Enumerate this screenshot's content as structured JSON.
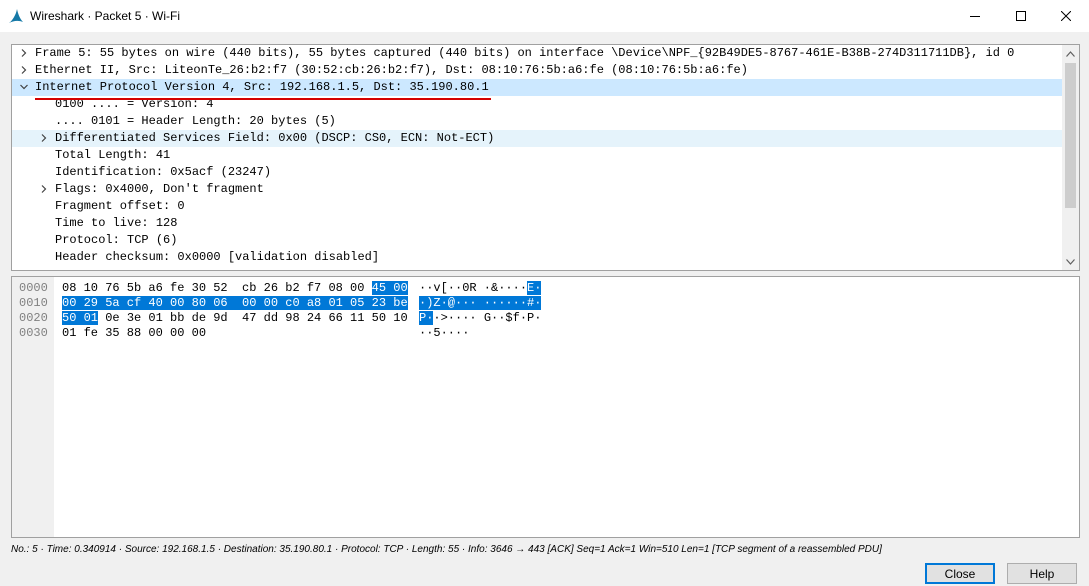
{
  "window": {
    "title": "Wireshark · Packet 5 · Wi-Fi",
    "app_icon": "wireshark-fin-icon",
    "controls": [
      "minimize-icon",
      "maximize-icon",
      "close-icon"
    ]
  },
  "tree": [
    {
      "text": "Frame 5: 55 bytes on wire (440 bits), 55 bytes captured (440 bits) on interface \\Device\\NPF_{92B49DE5-8767-461E-B38B-274D311711DB}, id 0",
      "expander": "collapsed",
      "state": "normal"
    },
    {
      "text": "Ethernet II, Src: LiteonTe_26:b2:f7 (30:52:cb:26:b2:f7), Dst: 08:10:76:5b:a6:fe (08:10:76:5b:a6:fe)",
      "expander": "collapsed",
      "state": "normal"
    },
    {
      "text": "Internet Protocol Version 4, Src: 192.168.1.5, Dst: 35.190.80.1",
      "expander": "expanded",
      "state": "selected"
    },
    {
      "text": "0100 .... = Version: 4",
      "expander": "none",
      "state": "normal"
    },
    {
      "text": ".... 0101 = Header Length: 20 bytes (5)",
      "expander": "none",
      "state": "normal"
    },
    {
      "text": "Differentiated Services Field: 0x00 (DSCP: CS0, ECN: Not-ECT)",
      "expander": "collapsed",
      "state": "highlight"
    },
    {
      "text": "Total Length: 41",
      "expander": "none",
      "state": "normal"
    },
    {
      "text": "Identification: 0x5acf (23247)",
      "expander": "none",
      "state": "normal"
    },
    {
      "text": "Flags: 0x4000, Don't fragment",
      "expander": "collapsed",
      "state": "normal"
    },
    {
      "text": "Fragment offset: 0",
      "expander": "none",
      "state": "normal"
    },
    {
      "text": "Time to live: 128",
      "expander": "none",
      "state": "normal"
    },
    {
      "text": "Protocol: TCP (6)",
      "expander": "none",
      "state": "normal"
    },
    {
      "text": "Header checksum: 0x0000 [validation disabled]",
      "expander": "none",
      "state": "normal"
    }
  ],
  "hex": [
    {
      "offset": "0000",
      "hex_plain": "08 10 76 5b a6 fe 30 52  cb 26 b2 f7 08 00 ",
      "hex_sel": "45 00",
      "ascii_plain": "··v[··0R ·&····",
      "ascii_sel": "E·"
    },
    {
      "offset": "0010",
      "hex_plain": "",
      "hex_sel": "00 29 5a cf 40 00 80 06  00 00 c0 a8 01 05 23 be",
      "ascii_plain": "",
      "ascii_sel": "·)Z·@··· ······#·"
    },
    {
      "offset": "0020",
      "hex_plain": "0e 3e 01 bb de 9d  47 dd 98 24 66 11 50 10",
      "hex_sel": "50 01",
      "ascii_plain": "·>···· G··$f·P·",
      "ascii_sel": "P·"
    },
    {
      "offset": "0030",
      "hex_plain": "01 fe 35 88 00 00 00",
      "hex_sel": "",
      "ascii_plain": "··5····",
      "ascii_sel": ""
    }
  ],
  "status": {
    "text": "No.: 5 · Time: 0.340914 · Source: 192.168.1.5 · Destination: 35.190.80.1 · Protocol: TCP · Length: 55 · Info: 3646 → 443 [ACK] Seq=1 Ack=1 Win=510 Len=1 [TCP segment of a reassembled PDU]"
  },
  "buttons": {
    "close_label": "Close",
    "help_label": "Help"
  },
  "colors": {
    "selected_row": "#cce8ff",
    "highlight_row": "#e5f3fb",
    "byte_selection": "#0078d7",
    "underline_annotation": "#d40000"
  }
}
